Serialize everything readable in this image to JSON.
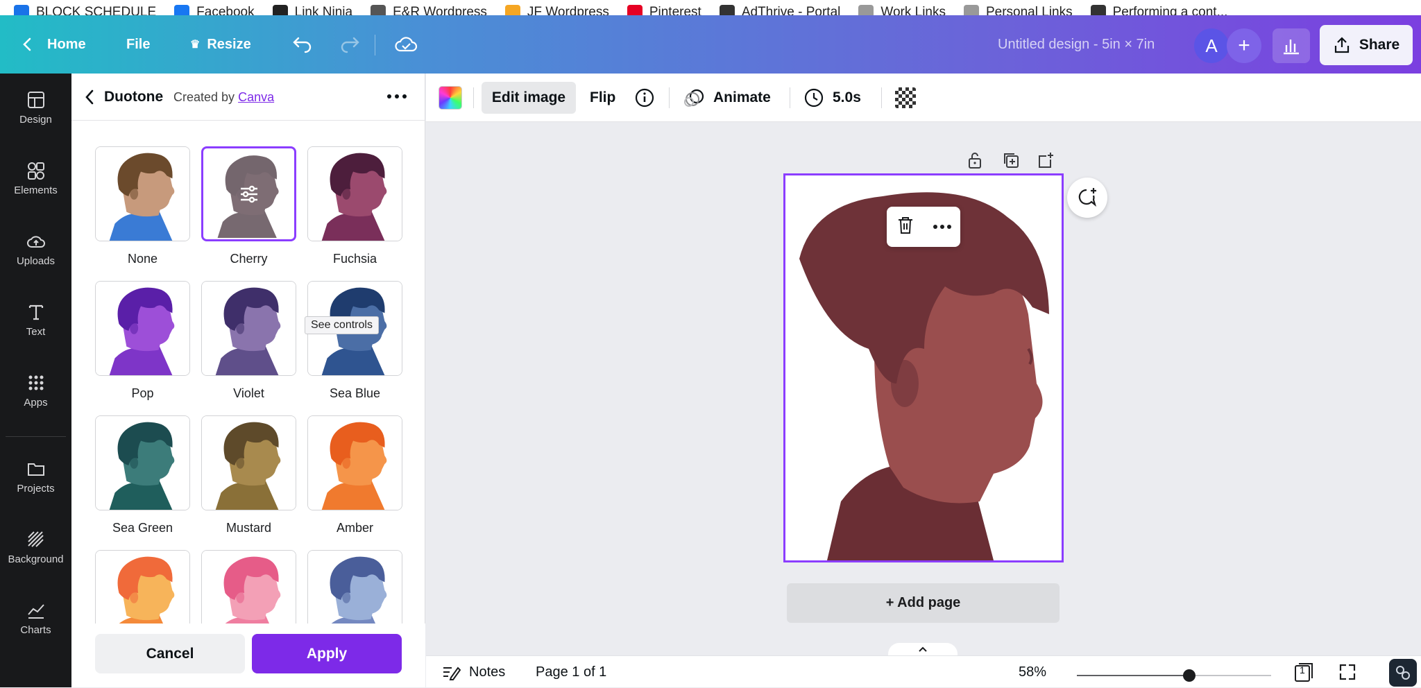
{
  "bookmarks": [
    {
      "label": "BLOCK SCHEDULE",
      "color": "#1a73e8"
    },
    {
      "label": "Facebook",
      "color": "#1877f2"
    },
    {
      "label": "Link Ninja",
      "color": "#222222"
    },
    {
      "label": "E&R Wordpress",
      "color": "#555555"
    },
    {
      "label": "JF Wordpress",
      "color": "#f5a623"
    },
    {
      "label": "Pinterest",
      "color": "#e60023"
    },
    {
      "label": "AdThrive - Portal",
      "color": "#333333"
    },
    {
      "label": "Work Links",
      "color": "#999999"
    },
    {
      "label": "Personal Links",
      "color": "#999999"
    },
    {
      "label": "Performing a cont...",
      "color": "#333333"
    }
  ],
  "topbar": {
    "home": "Home",
    "file": "File",
    "resize": "Resize",
    "title": "Untitled design - 5in × 7in",
    "avatar_letter": "A",
    "share": "Share"
  },
  "rail": [
    {
      "label": "Design",
      "icon": "layout-icon"
    },
    {
      "label": "Elements",
      "icon": "shapes-icon"
    },
    {
      "label": "Uploads",
      "icon": "cloud-upload-icon"
    },
    {
      "label": "Text",
      "icon": "text-icon"
    },
    {
      "label": "Apps",
      "icon": "apps-grid-icon"
    },
    {
      "label": "Projects",
      "icon": "folder-icon"
    },
    {
      "label": "Background",
      "icon": "hatch-icon"
    },
    {
      "label": "Charts",
      "icon": "line-chart-icon"
    }
  ],
  "panel": {
    "title": "Duotone",
    "created_by_prefix": "Created by",
    "creator": "Canva",
    "tooltip": "See controls",
    "cancel": "Cancel",
    "apply": "Apply",
    "presets": [
      {
        "label": "None",
        "skin": "#c79a7c",
        "hair": "#6b4a2c",
        "shirt": "#3a7bd5",
        "selected": false
      },
      {
        "label": "Cherry",
        "skin": "#3a1f2a",
        "hair": "#2a1520",
        "shirt": "#2f1a24",
        "selected": true
      },
      {
        "label": "Fuchsia",
        "skin": "#9b4a6e",
        "hair": "#4d1e3c",
        "shirt": "#7a2f5a",
        "selected": false
      },
      {
        "label": "Pop",
        "skin": "#9d4fd8",
        "hair": "#5a1fa8",
        "shirt": "#7e35c8",
        "selected": false
      },
      {
        "label": "Violet",
        "skin": "#8a74ad",
        "hair": "#3f2f6a",
        "shirt": "#5f4f8a",
        "selected": false
      },
      {
        "label": "Sea Blue",
        "skin": "#4b6ea6",
        "hair": "#1f3c6e",
        "shirt": "#2f5490",
        "selected": false
      },
      {
        "label": "Sea Green",
        "skin": "#3c7c7a",
        "hair": "#1c4c50",
        "shirt": "#1f5e5c",
        "selected": false
      },
      {
        "label": "Mustard",
        "skin": "#a88a4e",
        "hair": "#5e4a2a",
        "shirt": "#8a7038",
        "selected": false
      },
      {
        "label": "Amber",
        "skin": "#f5954a",
        "hair": "#e85e1e",
        "shirt": "#f07a2e",
        "selected": false
      },
      {
        "label": "",
        "skin": "#f7b45a",
        "hair": "#f06a3a",
        "shirt": "#f48a3a",
        "selected": false
      },
      {
        "label": "",
        "skin": "#f3a0b6",
        "hair": "#e65c88",
        "shirt": "#ef7ea0",
        "selected": false
      },
      {
        "label": "",
        "skin": "#9ab0d8",
        "hair": "#4a5e9a",
        "shirt": "#7488c0",
        "selected": false
      }
    ]
  },
  "ctx": {
    "edit_image": "Edit image",
    "flip": "Flip",
    "animate": "Animate",
    "duration": "5.0s"
  },
  "canvas": {
    "add_page": "+ Add page",
    "photo_skin": "#9a4e4e",
    "photo_hair": "#6e3238",
    "photo_shirt": "#6a2e34"
  },
  "bottombar": {
    "notes": "Notes",
    "page_indicator": "Page 1 of 1",
    "zoom": "58%",
    "zoom_fraction": 0.58,
    "page_count": "1"
  },
  "colors": {
    "accent": "#7d2ae8",
    "selection": "#8b3dff"
  }
}
